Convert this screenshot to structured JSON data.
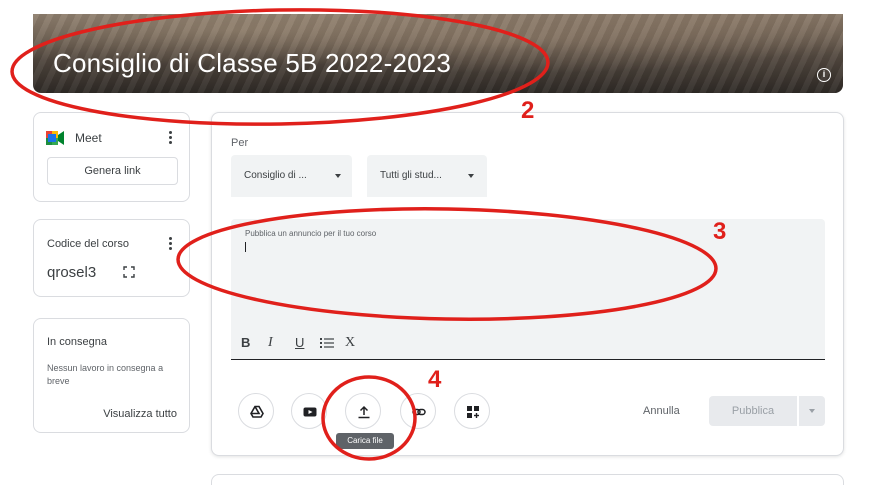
{
  "banner": {
    "title": "Consiglio di Classe 5B 2022-2023",
    "info_icon": "info-icon"
  },
  "meet": {
    "label": "Meet",
    "button_label": "Genera link",
    "icon": "meet-logo-icon"
  },
  "course_code": {
    "label": "Codice del corso",
    "value": "qrosel3",
    "icon": "fullscreen-icon"
  },
  "due": {
    "title": "In consegna",
    "text": "Nessun lavoro in consegna a breve",
    "link": "Visualizza tutto"
  },
  "composer": {
    "for_label": "Per",
    "class_select": "Consiglio di ...",
    "students_select": "Tutti gli stud...",
    "placeholder": "Pubblica un annuncio per il tuo corso",
    "format_bold": "B",
    "format_italic": "I",
    "format_underline": "U",
    "format_clear": "X",
    "attach_icons": [
      "drive-icon",
      "youtube-icon",
      "upload-icon",
      "link-icon",
      "create-icon"
    ],
    "upload_tooltip": "Carica file",
    "cancel_label": "Annulla",
    "publish_label": "Pubblica"
  },
  "annotations": {
    "n2": "2",
    "n3": "3",
    "n4": "4",
    "color": "#e0201b"
  }
}
